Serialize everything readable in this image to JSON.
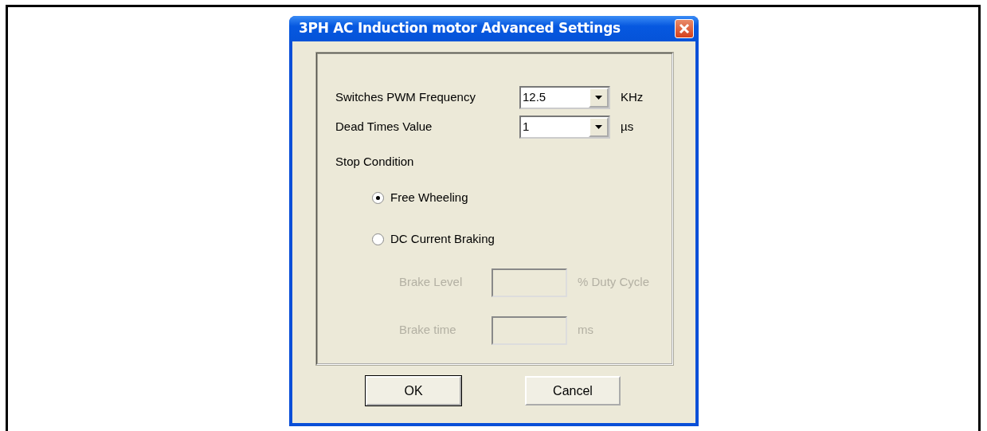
{
  "window": {
    "title": "3PH AC Induction motor Advanced Settings"
  },
  "settings": [
    {
      "label": "Switches PWM Frequency",
      "value": "12.5",
      "unit": "KHz"
    },
    {
      "label": "Dead Times Value",
      "value": "1",
      "unit": "µs"
    }
  ],
  "stop_condition": {
    "label": "Stop Condition",
    "options": [
      {
        "label": "Free Wheeling",
        "selected": true
      },
      {
        "label": "DC Current Braking",
        "selected": false
      }
    ]
  },
  "brake_fields": [
    {
      "label": "Brake Level",
      "unit": "% Duty Cycle",
      "disabled": true
    },
    {
      "label": "Brake time",
      "unit": "ms",
      "disabled": true
    }
  ],
  "buttons": [
    {
      "label": "OK",
      "default": true
    },
    {
      "label": "Cancel",
      "default": false
    }
  ]
}
